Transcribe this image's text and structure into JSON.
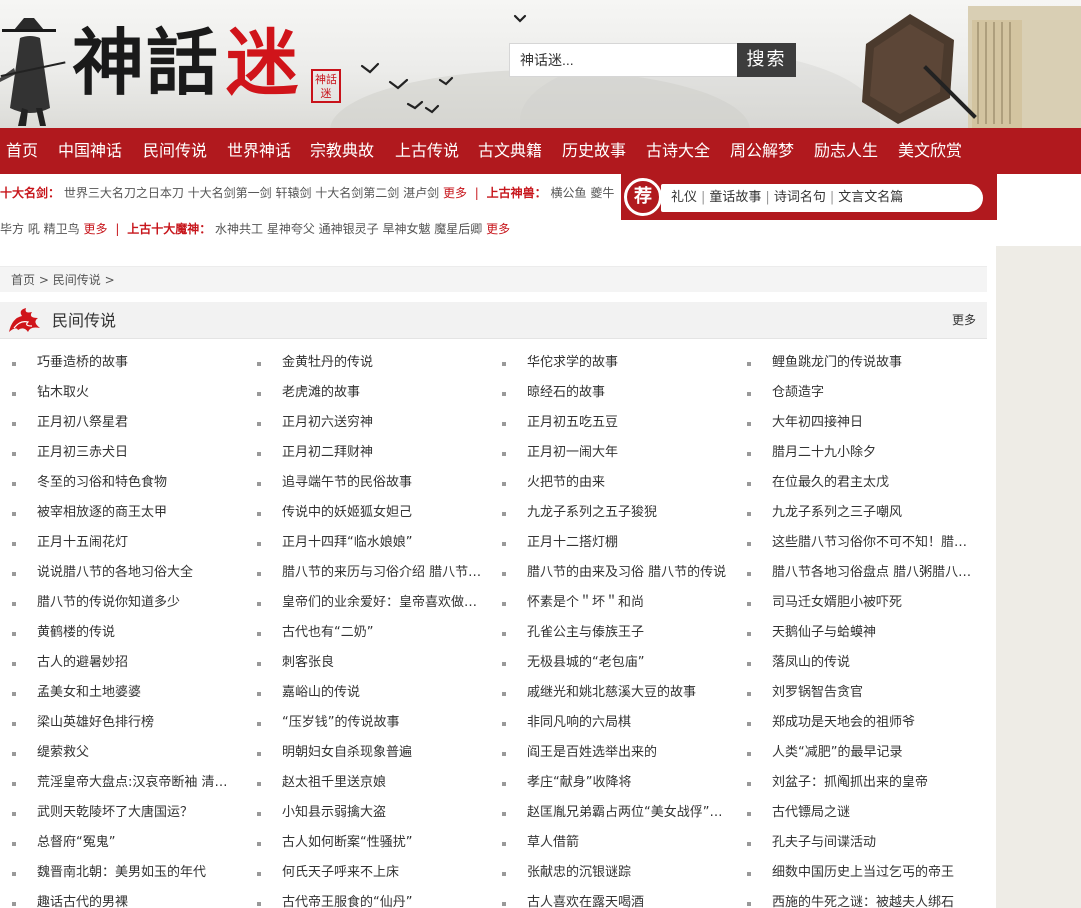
{
  "logo": {
    "char1": "神",
    "char2": "話",
    "char3": "迷",
    "seal": "神話迷"
  },
  "search": {
    "value": "神话迷...",
    "button": "搜索"
  },
  "nav": [
    "首页",
    "中国神话",
    "民间传说",
    "世界神话",
    "宗教典故",
    "上古传说",
    "古文典籍",
    "历史故事",
    "古诗大全",
    "周公解梦",
    "励志人生",
    "美文欣赏"
  ],
  "info_line1": {
    "label1": "十大名剑：",
    "items1": "世界三大名刀之日本刀  十大名剑第一剑 轩辕剑  十大名剑第二剑 湛卢剑",
    "more1": "更多",
    "label2": "上古神兽：",
    "items2": "横公鱼  夔牛"
  },
  "info_line2": {
    "items0": "毕方 吼  精卫鸟",
    "more0": "更多",
    "label": "上古十大魔神：",
    "items": "水神共工  星神夸父  通神银灵子  旱神女魃  魔星后卿",
    "more": "更多"
  },
  "recommend": {
    "badge": "荐",
    "links": [
      "礼仪",
      "童话故事",
      "诗词名句",
      "文言文名篇"
    ]
  },
  "breadcrumb": {
    "home": "首页",
    "sep": ">",
    "current": "民间传说"
  },
  "section": {
    "title": "民间传说",
    "more": "更多"
  },
  "stories": [
    [
      "巧垂造桥的故事",
      "金黄牡丹的传说",
      "华佗求学的故事",
      "鲤鱼跳龙门的传说故事"
    ],
    [
      "钻木取火",
      "老虎滩的故事",
      "晾经石的故事",
      "仓颉造字"
    ],
    [
      "正月初八祭星君",
      "正月初六送穷神",
      "正月初五吃五豆",
      "大年初四接神日"
    ],
    [
      "正月初三赤犬日",
      "正月初二拜财神",
      "正月初一闹大年",
      "腊月二十九小除夕"
    ],
    [
      "冬至的习俗和特色食物",
      "追寻端午节的民俗故事",
      "火把节的由来",
      "在位最久的君主太戊"
    ],
    [
      "被宰相放逐的商王太甲",
      "传说中的妖姬狐女妲己",
      "九龙子系列之五子狻猊",
      "九龙子系列之三子嘲风"
    ],
    [
      "正月十五闹花灯",
      "正月十四拜“临水娘娘”",
      "正月十二搭灯棚",
      "这些腊八节习俗你不可不知！腊…"
    ],
    [
      "说说腊八节的各地习俗大全",
      "腊八节的来历与习俗介绍 腊八节…",
      "腊八节的由来及习俗 腊八节的传说",
      "腊八节各地习俗盘点 腊八粥腊八…"
    ],
    [
      "腊八节的传说你知道多少",
      "皇帝们的业余爱好：皇帝喜欢做…",
      "怀素是个＂坏＂和尚",
      "司马迁女婿胆小被吓死"
    ],
    [
      "黄鹤楼的传说",
      "古代也有“二奶”",
      "孔雀公主与傣族王子",
      "天鹅仙子与蛤蟆神"
    ],
    [
      "古人的避暑妙招",
      "刺客张良",
      "无极县城的“老包庙”",
      "落凤山的传说"
    ],
    [
      "孟美女和土地婆婆",
      "嘉峪山的传说",
      "戚继光和姚北慈溪大豆的故事",
      "刘罗锅智告贪官"
    ],
    [
      "梁山英雄好色排行榜",
      "“压岁钱”的传说故事",
      "非同凡响的六局棋",
      "郑成功是天地会的祖师爷"
    ],
    [
      "缇萦救父",
      "明朝妇女自杀现象普遍",
      "阎王是百姓选举出来的",
      "人类“减肥”的最早记录"
    ],
    [
      "荒淫皇帝大盘点:汉哀帝断袖 清…",
      "赵太祖千里送京娘",
      "孝庄“献身”收降将",
      "刘盆子：抓阄抓出来的皇帝"
    ],
    [
      "武则天乾陵坏了大唐国运？",
      "小知县示弱擒大盗",
      "赵匡胤兄弟霸占两位“美女战俘”…",
      "古代镖局之谜"
    ],
    [
      "总督府“冤鬼”",
      "古人如何断案“性骚扰”",
      "草人借箭",
      "孔夫子与间谍活动"
    ],
    [
      "魏晋南北朝：美男如玉的年代",
      "何氏天子呼来不上床",
      "张献忠的沉银谜踪",
      "细数中国历史上当过乞丐的帝王"
    ],
    [
      "趣话古代的男裸",
      "古代帝王服食的“仙丹”",
      "古人喜欢在露天喝酒",
      "西施的牛死之谜：被越夫人绑石"
    ]
  ]
}
